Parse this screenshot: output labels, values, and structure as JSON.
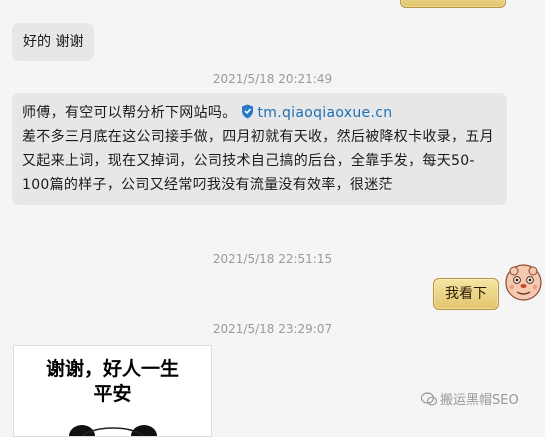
{
  "messages": {
    "msg1": "好的 谢谢",
    "time1": "2021/5/18 20:21:49",
    "msg2": {
      "prefix": "师傅，有空可以帮分析下网站吗。",
      "link": "tm.qiaoqiaoxue.cn",
      "body": "差不多三月底在这公司接手做，四月初就有天收，然后被降权卡收录，五月又起来上词，现在又掉词，公司技术自己搞的后台，全靠手发，每天50-100篇的样子，公司又经常叼我没有流量没有效率，很迷茫"
    },
    "time2": "2021/5/18 22:51:15",
    "msg3": "我看下",
    "time3": "2021/5/18 23:29:07"
  },
  "sticker": {
    "line1": "谢谢，好人一生",
    "line2": "平安"
  },
  "watermark": "搬运黑帽SEO",
  "colors": {
    "background": "#f5f5f5",
    "incoming_bubble": "#e7e7e7",
    "link": "#1d6fb8",
    "gold_bubble": "#e8cf7e"
  }
}
